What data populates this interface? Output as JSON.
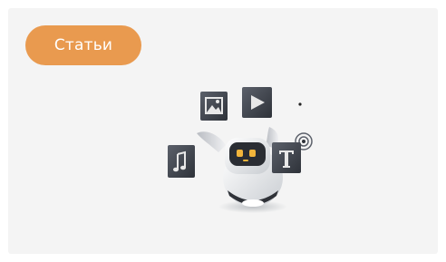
{
  "card": {
    "category_button_label": "Статьи"
  },
  "colors": {
    "card_background": "#f4f4f4",
    "button_background": "#e99a4f",
    "button_text": "#ffffff",
    "tile_dark": "#3b3f47",
    "robot_eye": "#f2b53b"
  },
  "illustration": {
    "subject": "robot",
    "tile_icons": [
      "image-icon",
      "play-icon",
      "music-note-icon",
      "text-icon"
    ]
  }
}
